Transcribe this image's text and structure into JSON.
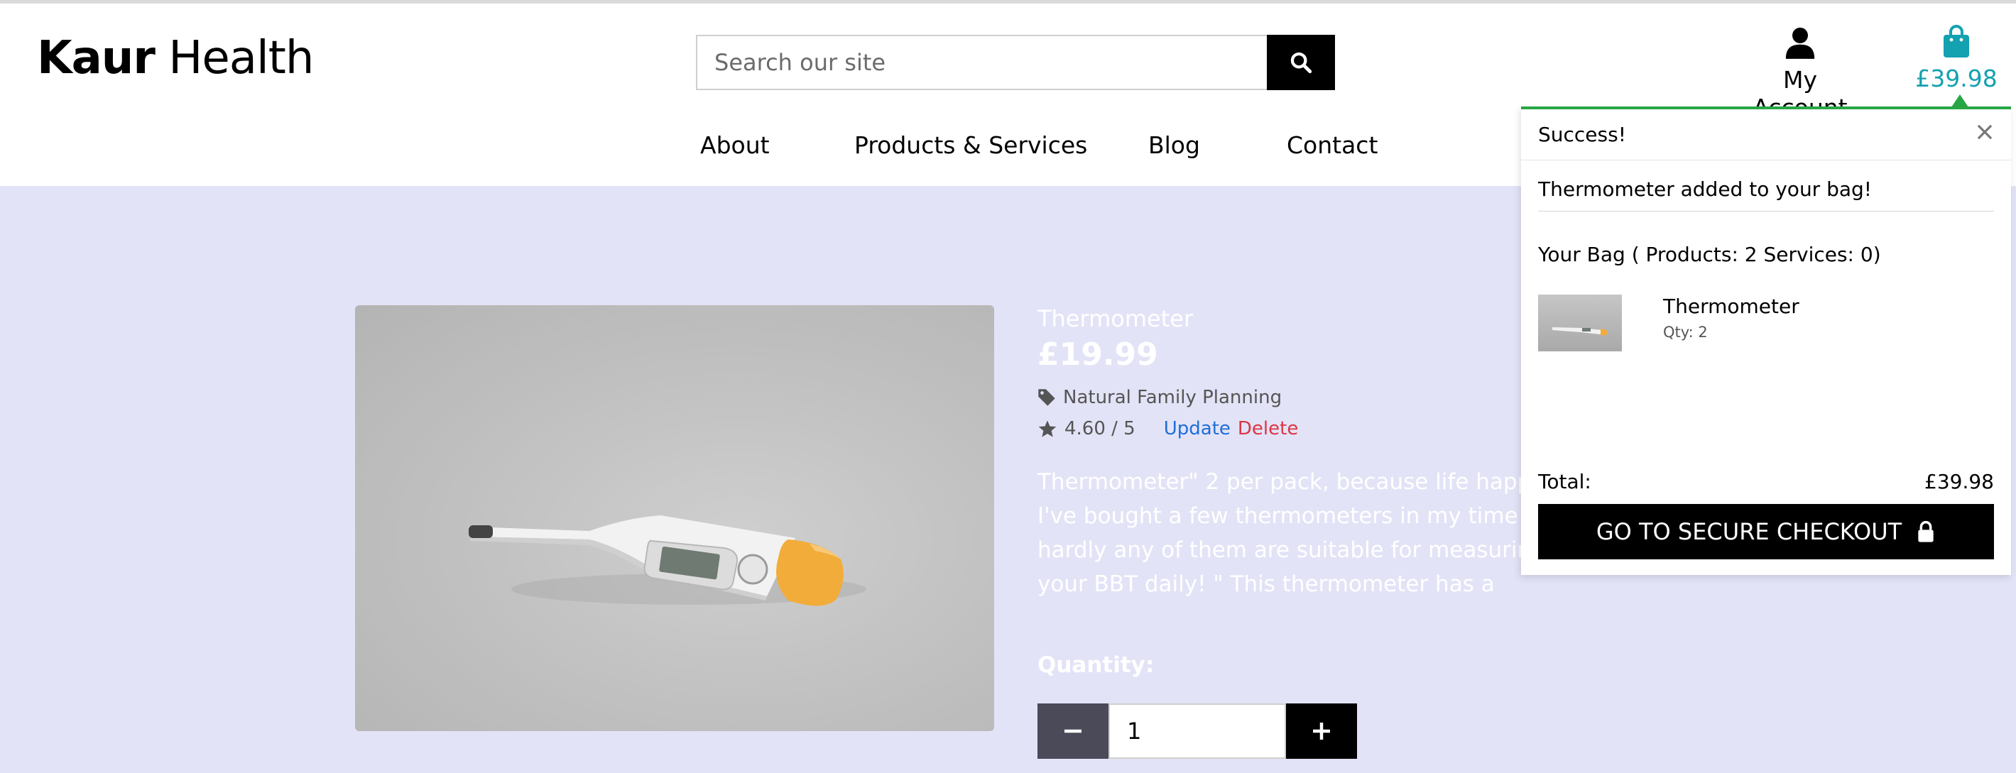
{
  "site": {
    "brand_bold": "Kaur",
    "brand_rest": " Health"
  },
  "search": {
    "placeholder": "Search our site"
  },
  "header": {
    "account_label": "My Account",
    "bag_total": "£39.98"
  },
  "nav": {
    "items": [
      "About",
      "Products & Services",
      "Blog",
      "Contact"
    ]
  },
  "product": {
    "name": "Thermometer",
    "price": "£19.99",
    "category": "Natural Family Planning",
    "rating": "4.60 / 5",
    "update_label": "Update",
    "delete_label": "Delete",
    "description": "Thermometer\" 2 per pack, because life happens. I've bought a few thermometers in my time and hardly any of them are suitable for measuring your BBT daily! \" This thermometer has a comfortable grip and flexible measuring point",
    "quantity_label": "Quantity:",
    "quantity_value": "1"
  },
  "toast": {
    "title": "Success!",
    "message": "Thermometer added to your bag!",
    "bag_summary": "Your Bag ( Products: 2 Services: 0)",
    "item_name": "Thermometer",
    "item_qty": "Qty: 2",
    "total_label": "Total:",
    "total_value": "£39.98",
    "checkout_label": "GO TO SECURE CHECKOUT"
  },
  "colors": {
    "accent": "#14a1b0",
    "success": "#28a745",
    "link": "#1e6ed8",
    "danger": "#dc3545",
    "page_bg": "#e3e3f7"
  }
}
